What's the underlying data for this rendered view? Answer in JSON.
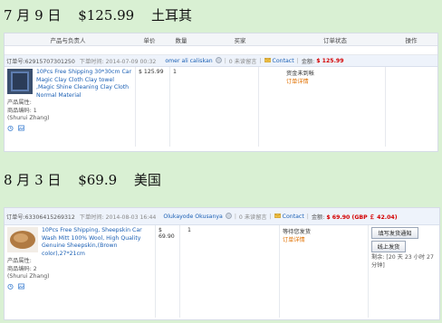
{
  "section1": {
    "date": "7 月 9 日",
    "amount": "$125.99",
    "country": "土耳其"
  },
  "section2": {
    "date": "8 月 3 日",
    "amount": "$69.9",
    "country": "美国"
  },
  "table_headers": [
    "产品与负责人",
    "单价",
    "数量",
    "买家",
    "订单状态",
    "操作"
  ],
  "order1": {
    "order_no": "订单号:62915707301250",
    "time": "下单时间: 2014-07-09 00:32",
    "buyer": "omer ali caliskan",
    "unread": "0 未读留言",
    "contact": "Contact",
    "amount_label": "金额:",
    "amount": "$ 125.99",
    "product_title": "10Pcs Free Shipping 30*30cm Car Magic Clay Cloth Clay towel ,Magic Shine Cleaning Clay Cloth Normal Material",
    "attr": "产品属性:",
    "code": "商品编码: 1",
    "owner": "(Shurui Zhang)",
    "price": "$ 125.99",
    "qty": "1",
    "status1": "资金未到帐",
    "status2": "订单详情"
  },
  "order2": {
    "order_no": "订单号:63306415269312",
    "time": "下单时间: 2014-08-03 16:44",
    "buyer": "Olukayode Okusanya",
    "unread": "0 未读留言",
    "contact": "Contact",
    "amount_label": "金额:",
    "amount": "$ 69.90 (GBP ￡ 42.04)",
    "product_title": "10Pcs Free Shipping, Sheepskin Car Wash Mitt 100% Wool, High Quality Genuine Sheepskin,(Brown color),27*21cm",
    "attr": "产品属性:",
    "code": "商品编码: 2",
    "owner": "(Shurui Zhang)",
    "price": "$ 69.90",
    "qty": "1",
    "status1": "等待您发货",
    "status2": "订单详情",
    "btn_notify": "填写发货通知",
    "btn_ship": "线上发货",
    "remaining": "剩余: [20 天 23 小时 27 分钟]"
  }
}
